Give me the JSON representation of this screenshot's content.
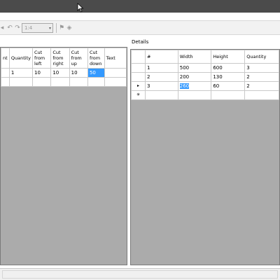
{
  "toolbar": {
    "zoom_value": "1:4"
  },
  "details_label": "Details",
  "left_grid": {
    "columns": [
      "nt",
      "Quantity",
      "Cut from left",
      "Cut from right",
      "Cut from up",
      "Cut from down",
      "Text"
    ],
    "rows": [
      [
        "",
        "1",
        "10",
        "10",
        "10",
        "50",
        ""
      ],
      [
        "",
        "",
        "",
        "",
        "",
        "",
        ""
      ]
    ]
  },
  "right_grid": {
    "columns": [
      "#",
      "Width",
      "Height",
      "Quantity"
    ],
    "row_indicators": [
      "",
      "",
      "▸",
      "✳"
    ],
    "rows": [
      [
        "1",
        "500",
        "600",
        "3"
      ],
      [
        "2",
        "200",
        "130",
        "2"
      ],
      [
        "3",
        "260",
        "60",
        "2"
      ],
      [
        "",
        "",
        "",
        ""
      ]
    ]
  },
  "colors": {
    "titlebar": "#4b4b4b",
    "grid_background": "#ababab",
    "selection": "#3399ff"
  }
}
